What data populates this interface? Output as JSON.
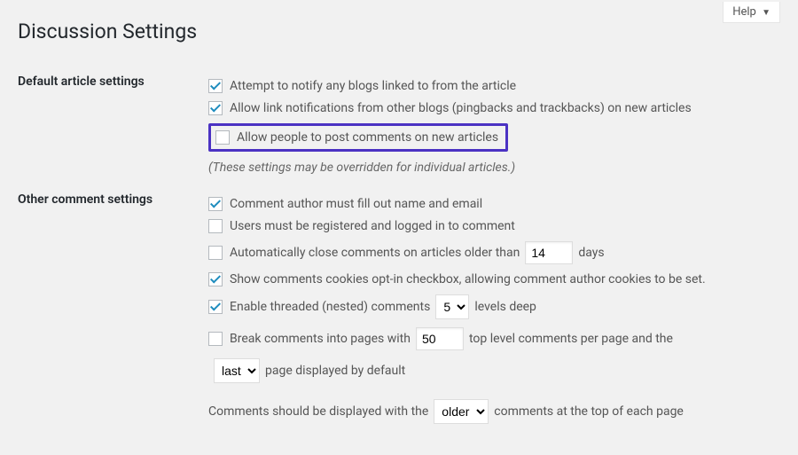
{
  "help_label": "Help",
  "page_title": "Discussion Settings",
  "section1": {
    "title": "Default article settings",
    "opt1": "Attempt to notify any blogs linked to from the article",
    "opt2": "Allow link notifications from other blogs (pingbacks and trackbacks) on new articles",
    "opt3": "Allow people to post comments on new articles",
    "note": "(These settings may be overridden for individual articles.)"
  },
  "section2": {
    "title": "Other comment settings",
    "opt1": "Comment author must fill out name and email",
    "opt2": "Users must be registered and logged in to comment",
    "opt3a": "Automatically close comments on articles older than",
    "opt3_val": "14",
    "opt3b": "days",
    "opt4": "Show comments cookies opt-in checkbox, allowing comment author cookies to be set.",
    "opt5a": "Enable threaded (nested) comments",
    "opt5_val": "5",
    "opt5b": "levels deep",
    "opt6a": "Break comments into pages with",
    "opt6_val": "50",
    "opt6b": "top level comments per page and the",
    "opt7_val": "last",
    "opt7b": "page displayed by default",
    "opt8a": "Comments should be displayed with the",
    "opt8_val": "older",
    "opt8b": "comments at the top of each page"
  }
}
